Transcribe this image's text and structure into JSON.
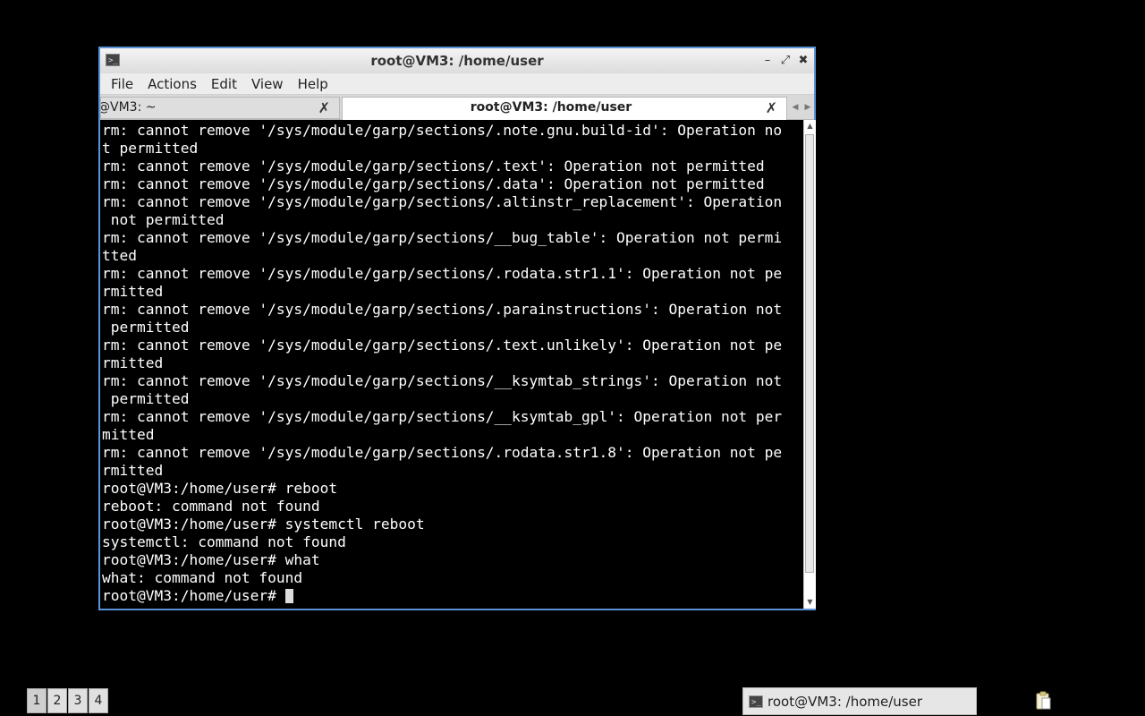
{
  "window": {
    "title": "root@VM3: /home/user",
    "controls": {
      "minimize": "–",
      "maximize": "⤢",
      "close": "✖"
    }
  },
  "menubar": {
    "items": [
      "File",
      "Actions",
      "Edit",
      "View",
      "Help"
    ]
  },
  "tabs": [
    {
      "label": "@VM3: ~",
      "active": false
    },
    {
      "label": "root@VM3: /home/user",
      "active": true
    }
  ],
  "terminal": {
    "lines": [
      "rm: cannot remove '/sys/module/garp/sections/.note.gnu.build-id': Operation no",
      "t permitted",
      "rm: cannot remove '/sys/module/garp/sections/.text': Operation not permitted",
      "rm: cannot remove '/sys/module/garp/sections/.data': Operation not permitted",
      "rm: cannot remove '/sys/module/garp/sections/.altinstr_replacement': Operation",
      " not permitted",
      "rm: cannot remove '/sys/module/garp/sections/__bug_table': Operation not permi",
      "tted",
      "rm: cannot remove '/sys/module/garp/sections/.rodata.str1.1': Operation not pe",
      "rmitted",
      "rm: cannot remove '/sys/module/garp/sections/.parainstructions': Operation not",
      " permitted",
      "rm: cannot remove '/sys/module/garp/sections/.text.unlikely': Operation not pe",
      "rmitted",
      "rm: cannot remove '/sys/module/garp/sections/__ksymtab_strings': Operation not",
      " permitted",
      "rm: cannot remove '/sys/module/garp/sections/__ksymtab_gpl': Operation not per",
      "mitted",
      "rm: cannot remove '/sys/module/garp/sections/.rodata.str1.8': Operation not pe",
      "rmitted",
      "root@VM3:/home/user# reboot",
      "reboot: command not found",
      "root@VM3:/home/user# systemctl reboot",
      "systemctl: command not found",
      "root@VM3:/home/user# what",
      "what: command not found"
    ],
    "prompt": "root@VM3:/home/user# "
  },
  "taskbar": {
    "desktops": [
      "1",
      "2",
      "3",
      "4"
    ],
    "active_desktop": "1",
    "task_label": "root@VM3: /home/user"
  },
  "colors": {
    "background": "#000000",
    "window_border": "#5b93d6",
    "terminal_text": "#ffffff"
  },
  "icons": {
    "app": "terminal-icon",
    "tab_close": "close-icon",
    "tray": "clipboard-icon"
  }
}
